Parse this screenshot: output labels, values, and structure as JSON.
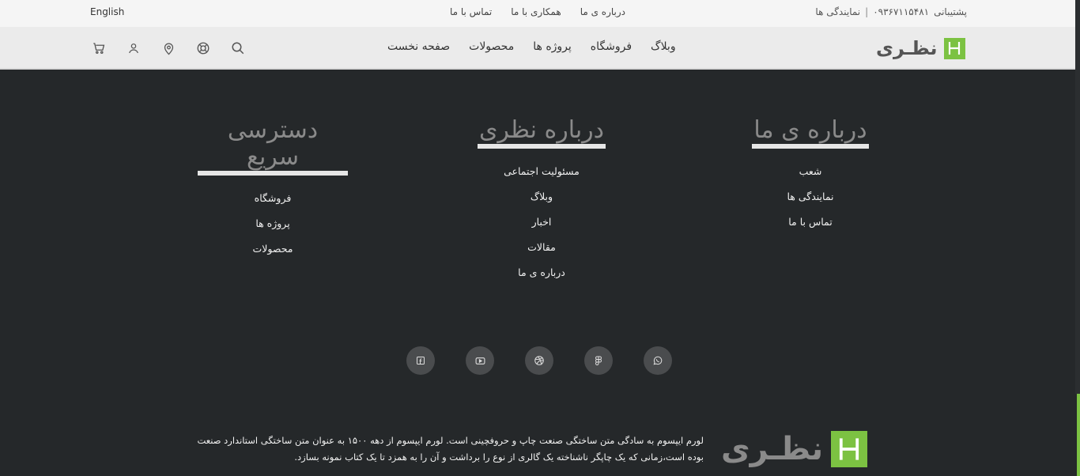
{
  "topbar": {
    "language": "English",
    "links": [
      "درباره ی ما",
      "همکاری با ما",
      "تماس با ما"
    ],
    "support_label": "پشتیبانی",
    "support_phone": "۰۹۳۶۷۱۱۵۴۸۱",
    "separator": "|",
    "agencies": "نمایندگی ها"
  },
  "header": {
    "logo_text": "نظـری",
    "nav": [
      "صفحه نخست",
      "محصولات",
      "پروژه ها",
      "فروشگاه",
      "وبلاگ"
    ],
    "icons": [
      "cart-icon",
      "user-icon",
      "location-icon",
      "support-icon",
      "search-icon"
    ]
  },
  "footer": {
    "columns": [
      {
        "title": "درباره ی ما",
        "items": [
          "شعب",
          "نمایندگی ها",
          "تماس با ما"
        ]
      },
      {
        "title": "درباره نظری",
        "items": [
          "مسئولیت اجتماعی",
          "وبلاگ",
          "اخبار",
          "مقالات",
          "درباره ی ما"
        ]
      },
      {
        "title": "دسترسی سریع",
        "items": [
          "فروشگاه",
          "پروژه ها",
          "محصولات"
        ]
      }
    ],
    "social": [
      "facebook-icon",
      "youtube-icon",
      "dribbble-icon",
      "figma-icon",
      "whatsapp-icon"
    ],
    "logo_text": "نظـری",
    "description": "لورم ایپسوم به سادگی متن ساختگی صنعت چاپ و حروفچینی است. لورم ایپسوم از دهه ۱۵۰۰ به عنوان متن ساختگی استاندارد صنعت بوده است،زمانی که یک چاپگر ناشناخته یک گالری از نوع را برداشت و آن را به همزد تا یک کتاب نمونه بسازد."
  },
  "colors": {
    "brand": "#7cc242",
    "footer_bg": "#25282a"
  }
}
